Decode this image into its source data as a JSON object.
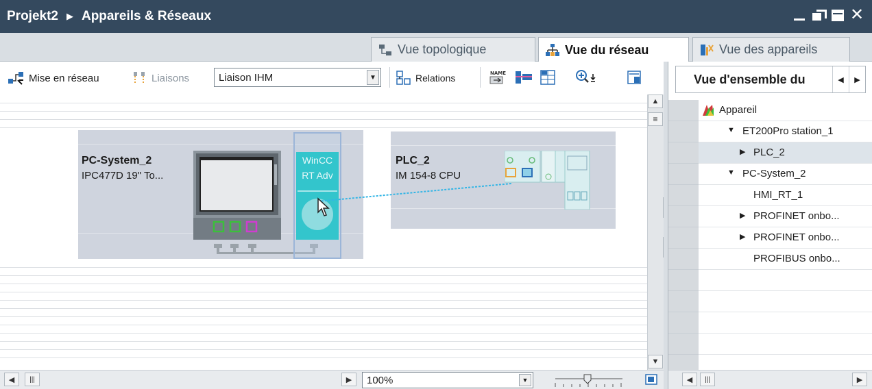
{
  "title_bar": {
    "project": "Projekt2",
    "section": "Appareils & Réseaux"
  },
  "view_tabs": [
    {
      "label": "Vue topologique",
      "active": false
    },
    {
      "label": "Vue du réseau",
      "active": true
    },
    {
      "label": "Vue des appareils",
      "active": false
    }
  ],
  "toolbar": {
    "network_label": "Mise en réseau",
    "connections_label": "Liaisons",
    "connection_type_value": "Liaison IHM",
    "relations_label": "Relations"
  },
  "canvas": {
    "devices": [
      {
        "name": "PC-System_2",
        "type": "IPC477D 19\" To..."
      },
      {
        "name": "PLC_2",
        "type": "IM 154-8 CPU"
      }
    ],
    "wincc_label_line1": "WinCC",
    "wincc_label_line2": "RT Adv"
  },
  "zoom": {
    "value": "100%"
  },
  "right_panel": {
    "tab_label": "Vue d'ensemble du",
    "column_header": "Appareil",
    "tree": [
      {
        "label": "ET200Pro station_1",
        "expander": "expanded",
        "level": 1,
        "selected": false
      },
      {
        "label": "PLC_2",
        "expander": "collapsed",
        "level": 2,
        "selected": true
      },
      {
        "label": "PC-System_2",
        "expander": "expanded",
        "level": 1,
        "selected": false
      },
      {
        "label": "HMI_RT_1",
        "expander": "none",
        "level": 2,
        "selected": false
      },
      {
        "label": "PROFINET onbo...",
        "expander": "collapsed",
        "level": 2,
        "selected": false
      },
      {
        "label": "PROFINET onbo...",
        "expander": "collapsed",
        "level": 2,
        "selected": false
      },
      {
        "label": "PROFIBUS onbo...",
        "expander": "none",
        "level": 2,
        "selected": false
      }
    ]
  },
  "colors": {
    "title_bar": "#34495e",
    "device_box": "#cfd4de",
    "wincc_teal": "#33c5cc",
    "connection_line": "#33b5e5"
  }
}
